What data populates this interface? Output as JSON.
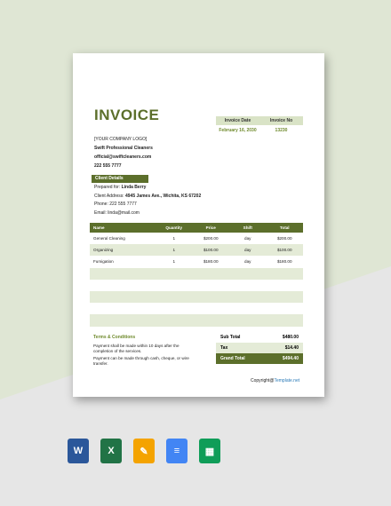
{
  "invoice": {
    "title": "INVOICE",
    "meta_headers": [
      "Invoice Date",
      "Invoice No"
    ],
    "meta_values": [
      "February 16, 2030",
      "13230"
    ]
  },
  "company": {
    "logo": "[YOUR COMPANY LOGO]",
    "name": "Swift Professional Cleaners",
    "email": "official@swiftcleaners.com",
    "phone": "222 555 7777"
  },
  "client": {
    "section_label": "Client Details",
    "prepared_for_label": "Prepared for:",
    "prepared_for": "Linda Berry",
    "address_label": "Client Address:",
    "address": "4945 James Ave., Wichita, KS 67202",
    "phone": "Phone: 222 555 7777",
    "email": "Email: linda@mail.com"
  },
  "table": {
    "headers": [
      "Name",
      "Quantity",
      "Price",
      "Shift",
      "Total"
    ],
    "rows": [
      [
        "General Cleaning",
        "1",
        "$200.00",
        "day",
        "$200.00"
      ],
      [
        "Organizing",
        "1",
        "$100.00",
        "day",
        "$100.00"
      ],
      [
        "Fumigation",
        "1",
        "$180.00",
        "day",
        "$180.00"
      ]
    ]
  },
  "terms": {
    "heading": "Terms & Conditions",
    "lines": [
      "Payment shall be made within 10 days after the completion of the services.",
      "Payment can be made through cash, cheque, or wire transfer."
    ]
  },
  "totals": {
    "sub_total_label": "Sub Total",
    "sub_total": "$480.00",
    "tax_label": "Tax",
    "tax": "$14.40",
    "grand_total_label": "Grand Total",
    "grand_total": "$494.40"
  },
  "footer": {
    "copyright": "Copyright@",
    "link": "Template.net"
  },
  "apps": [
    {
      "name": "word-icon",
      "glyph": "W"
    },
    {
      "name": "excel-icon",
      "glyph": "X"
    },
    {
      "name": "pages-icon",
      "glyph": "✎"
    },
    {
      "name": "docs-icon",
      "glyph": "≡"
    },
    {
      "name": "sheets-icon",
      "glyph": "▦"
    }
  ]
}
